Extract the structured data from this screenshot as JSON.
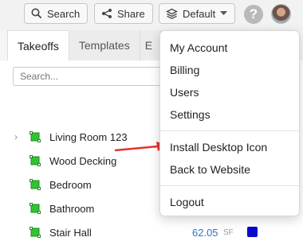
{
  "toolbar": {
    "search_label": "Search",
    "share_label": "Share",
    "default_label": "Default"
  },
  "tabs": [
    {
      "label": "Takeoffs"
    },
    {
      "label": "Templates"
    },
    {
      "label": "E"
    }
  ],
  "search": {
    "placeholder": "Search..."
  },
  "tree": [
    {
      "label": "Living Room 123",
      "expandable": true
    },
    {
      "label": "Wood Decking"
    },
    {
      "label": "Bedroom"
    },
    {
      "label": "Bathroom"
    },
    {
      "label": "Stair Hall",
      "value": "62.05",
      "unit": "SF",
      "swatch_color": "#0a0acd"
    }
  ],
  "menu": {
    "items": [
      "My Account",
      "Billing",
      "Users",
      "Settings"
    ],
    "items2": [
      "Install Desktop Icon",
      "Back to Website"
    ],
    "items3": [
      "Logout"
    ]
  },
  "colors": {
    "polygon_green": "#34c234",
    "accent_blue": "#2a73c2",
    "arrow_red": "#e8322b"
  },
  "icons": [
    "search-icon",
    "share-icon",
    "layers-icon",
    "chevron-down-icon",
    "help-icon",
    "avatar",
    "polygon-icon",
    "arrow-annotation"
  ]
}
